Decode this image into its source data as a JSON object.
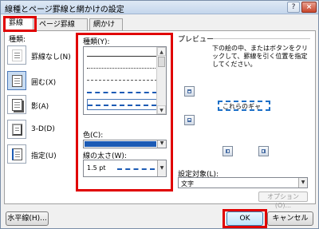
{
  "window": {
    "title": "線種とページ罫線と網かけの設定",
    "help_label": "?",
    "close_label": "×"
  },
  "tabs": [
    {
      "label": "罫線",
      "selected": true
    },
    {
      "label": "ページ罫線",
      "selected": false
    },
    {
      "label": "網かけ",
      "selected": false
    }
  ],
  "settings": {
    "title": "種類:",
    "items": [
      {
        "label": "罫線なし(N)"
      },
      {
        "label": "囲む(X)"
      },
      {
        "label": "影(A)"
      },
      {
        "label": "3-D(D)"
      },
      {
        "label": "指定(U)"
      }
    ]
  },
  "style": {
    "title": "種類(Y):",
    "lines": [
      "solid",
      "dotted",
      "dashed-fine",
      "dashed",
      "dash-dot"
    ]
  },
  "color": {
    "label": "色(C):",
    "value": "#1c5bb5"
  },
  "width": {
    "label": "線の太さ(W):",
    "value": "1.5 pt"
  },
  "preview": {
    "title": "プレビュー",
    "hint": "下の絵の中、またはボタンをクリックして、罫線を引く位置を指定してください。",
    "sample_text": "これらのギャ"
  },
  "apply": {
    "label": "設定対象(L):",
    "value": "文字"
  },
  "buttons": {
    "options": "オプション(O)...",
    "horizontal_line": "水平線(H)...",
    "ok": "OK",
    "cancel": "キャンセル"
  },
  "colors": {
    "highlight": "#e00000",
    "accent": "#1c5bb5"
  }
}
